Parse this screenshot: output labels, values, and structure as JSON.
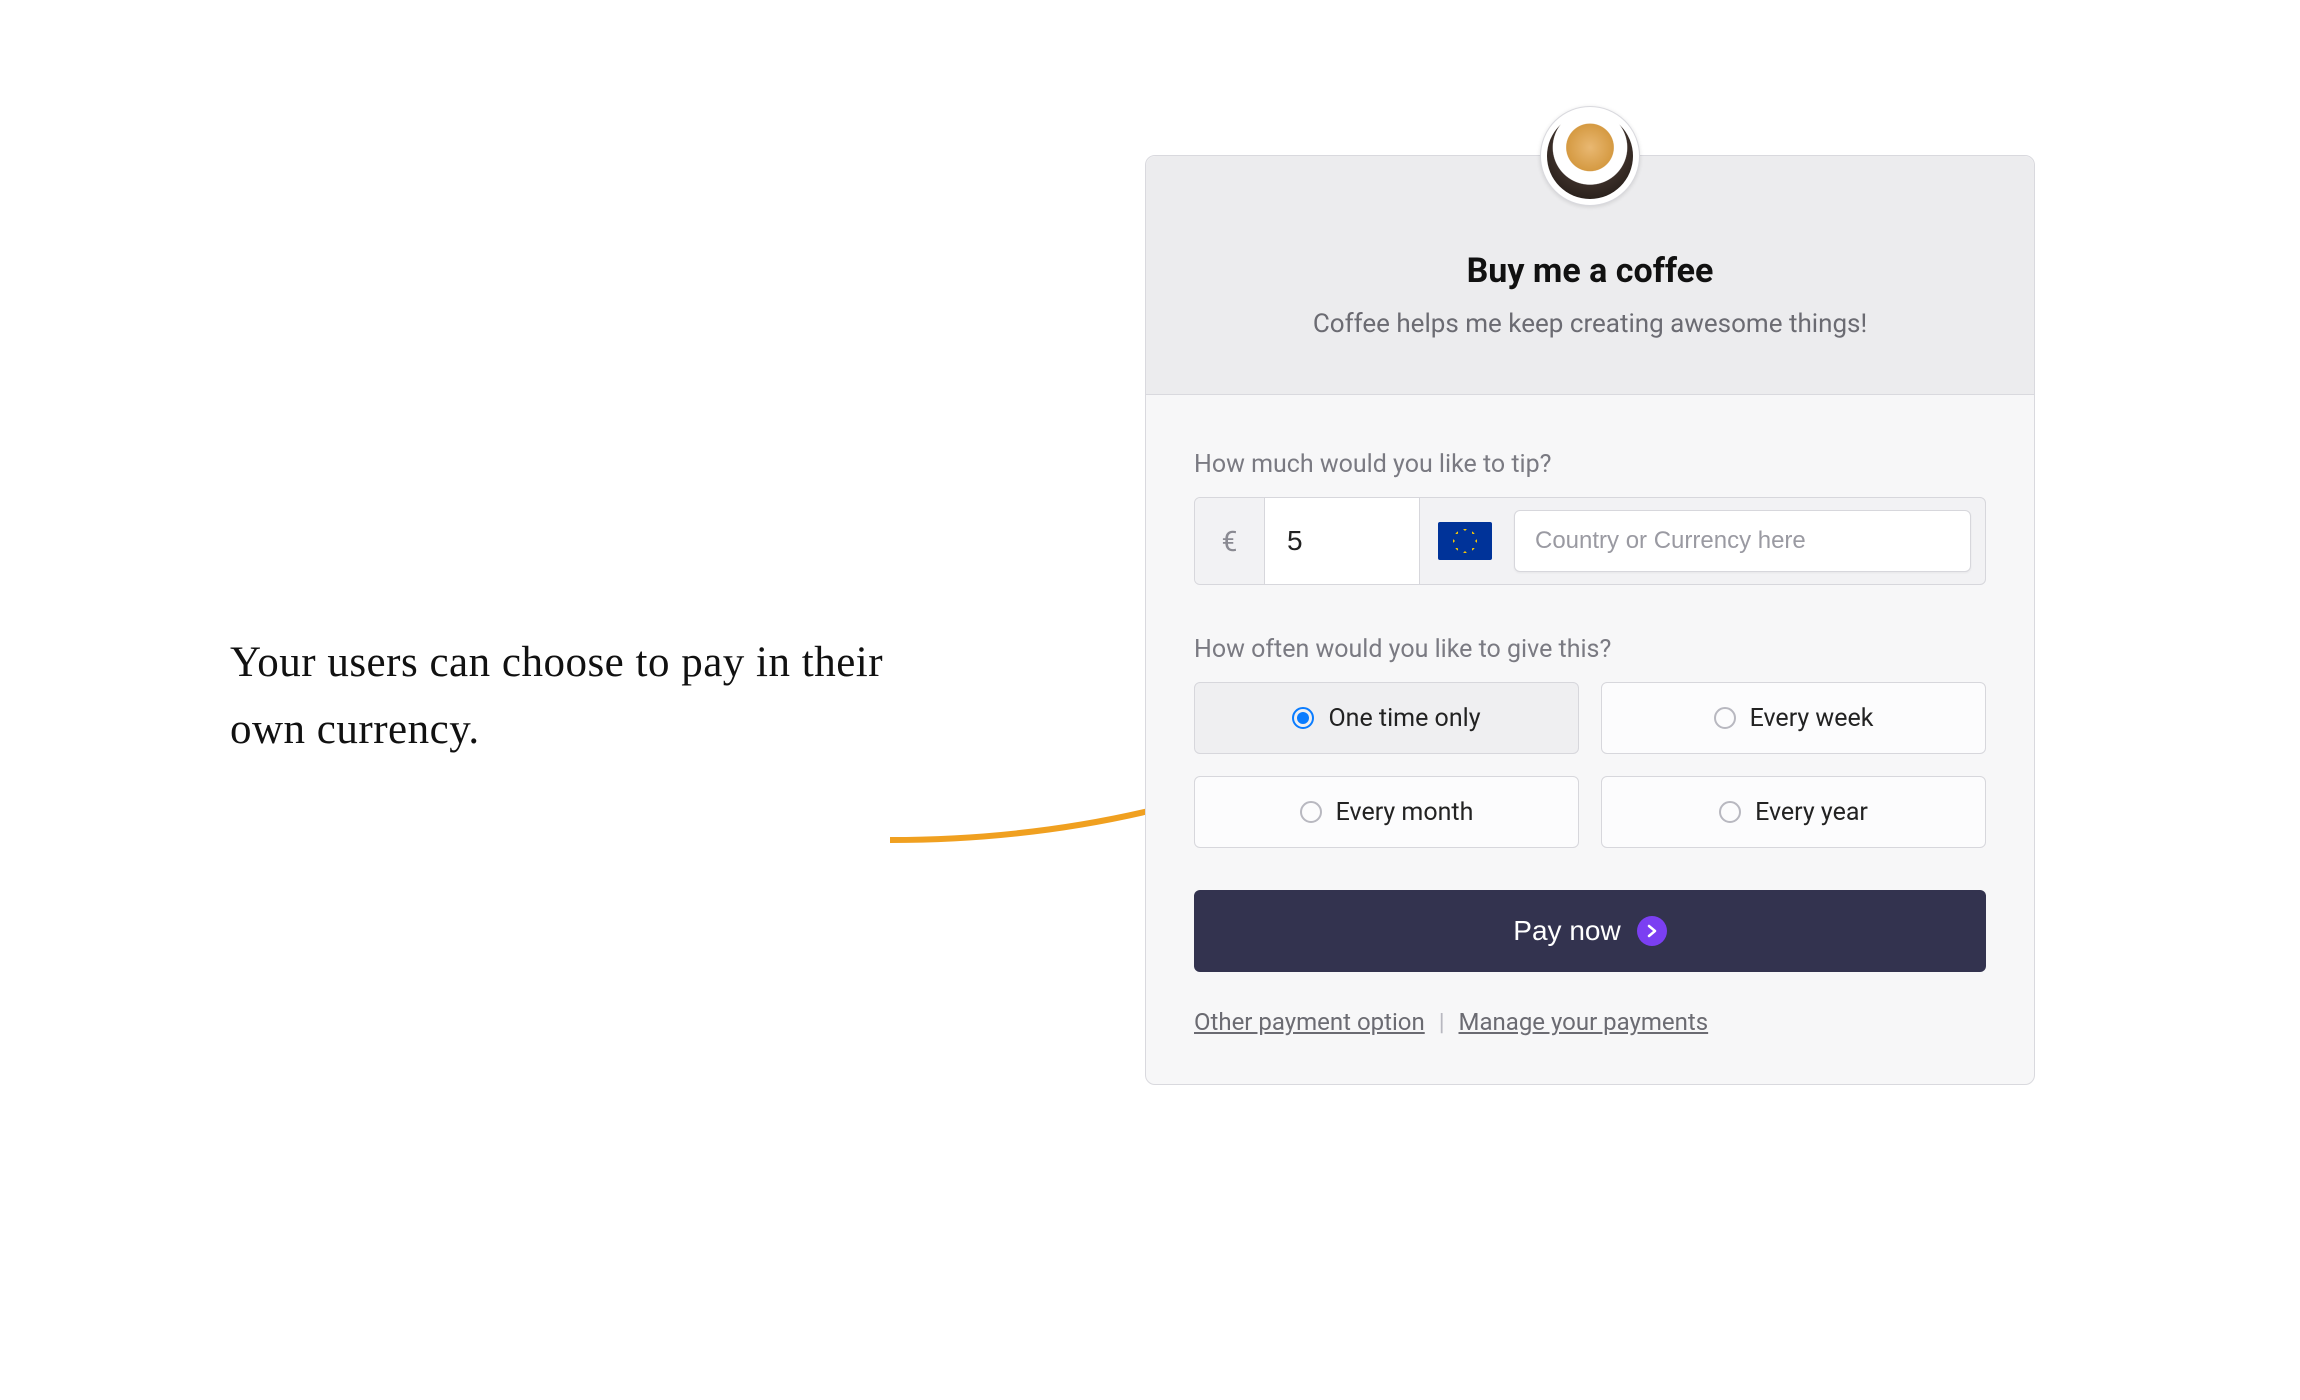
{
  "annotation": {
    "text": "Your users can choose to pay in their own currency."
  },
  "header": {
    "title": "Buy me a coffee",
    "subtitle": "Coffee helps me keep creating awesome things!"
  },
  "tip": {
    "label": "How much would you like to tip?",
    "currency_symbol": "€",
    "amount_value": "5",
    "flag": "eu",
    "currency_placeholder": "Country or Currency here"
  },
  "frequency": {
    "label": "How often would you like to give this?",
    "options": [
      {
        "label": "One time only",
        "selected": true
      },
      {
        "label": "Every week",
        "selected": false
      },
      {
        "label": "Every month",
        "selected": false
      },
      {
        "label": "Every year",
        "selected": false
      }
    ]
  },
  "pay_button": {
    "label": "Pay now"
  },
  "footer": {
    "other_payment": "Other payment option",
    "manage_payments": "Manage your payments"
  }
}
